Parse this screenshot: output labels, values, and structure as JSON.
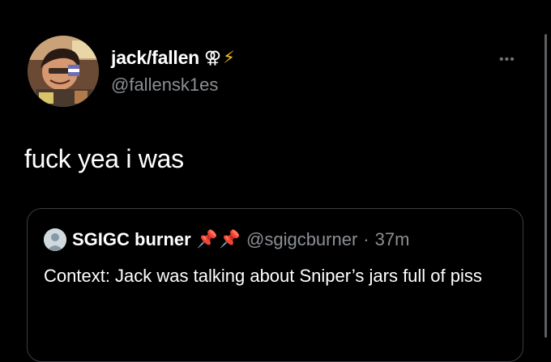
{
  "tweet": {
    "display_name": "jack/fallen",
    "name_glyphs": [
      "⚢",
      "⚡"
    ],
    "handle": "@fallensk1es",
    "more_label": "•••",
    "body": "fuck yea i was"
  },
  "quoted": {
    "display_name": "SGIGC burner",
    "pins": [
      "📌",
      "📌"
    ],
    "handle": "@sgigcburner",
    "separator": "·",
    "time": "37m",
    "text": "Context: Jack was talking about Sniper’s jars full of piss"
  },
  "icons": {
    "more": "ellipsis-icon",
    "quote_avatar": "default-avatar-icon"
  },
  "colors": {
    "background": "#000000",
    "text": "#ffffff",
    "secondary": "#8b8f94",
    "border": "#3a3d41"
  }
}
